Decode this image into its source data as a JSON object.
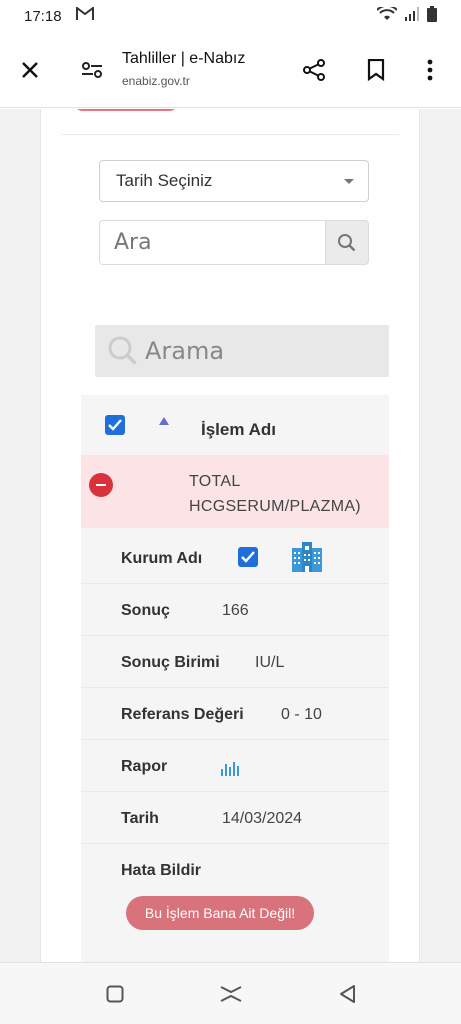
{
  "status": {
    "time": "17:18",
    "mail_icon": "gmail-icon"
  },
  "browser": {
    "title": "Tahliller | e-Nabız",
    "url": "enabiz.gov.tr"
  },
  "filters": {
    "date_placeholder": "Tarih Seçiniz",
    "search_placeholder": "Ara",
    "table_search_placeholder": "Arama"
  },
  "table": {
    "header": "İşlem Adı",
    "row_name": "TOTAL HCGSERUM/PLAZMA)",
    "details": {
      "institution_label": "Kurum Adı",
      "result_label": "Sonuç",
      "result_value": "166",
      "unit_label": "Sonuç Birimi",
      "unit_value": "IU/L",
      "reference_label": "Referans Değeri",
      "reference_value": "0 - 10",
      "report_label": "Rapor",
      "date_label": "Tarih",
      "date_value": "14/03/2024",
      "report_issue_label": "Hata Bildir",
      "not_mine_button": "Bu İşlem Bana Ait Değil!"
    }
  },
  "colors": {
    "accent": "#1e6fd9",
    "danger": "#d8323c",
    "pink_row": "#fce4e6",
    "button": "#d9737b",
    "icon_blue": "#3a9ad9"
  }
}
